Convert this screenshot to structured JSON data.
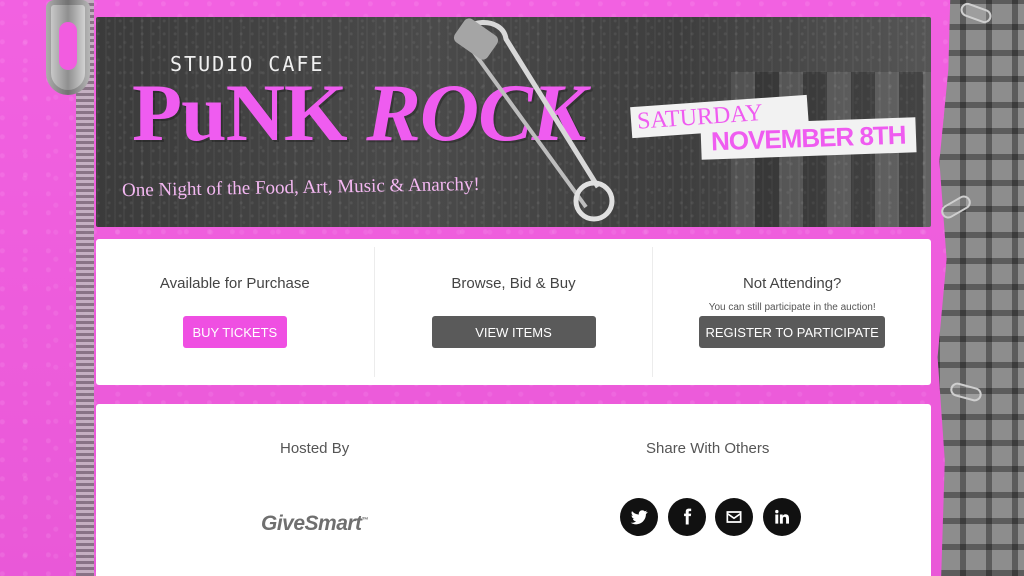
{
  "banner": {
    "venue": "STUDIO CAFE",
    "headline_word1": "PuNK",
    "headline_word2": "ROCK",
    "tagline": "One Night of the Food, Art, Music & Anarchy!",
    "date_day": "SATURDAY",
    "date_rest": "NOVEMBER 8TH"
  },
  "actions": {
    "purchase": {
      "title": "Available for Purchase",
      "button": "BUY TICKETS"
    },
    "browse": {
      "title": "Browse, Bid & Buy",
      "button": "VIEW ITEMS"
    },
    "register": {
      "title": "Not Attending?",
      "subtitle": "You can still participate in the auction!",
      "button": "REGISTER TO PARTICIPATE"
    }
  },
  "footer": {
    "hosted_title": "Hosted By",
    "host_name": "GiveSmart",
    "host_tm": "™",
    "share_title": "Share With Others",
    "social_icons": [
      "twitter-icon",
      "facebook-icon",
      "email-icon",
      "linkedin-icon"
    ]
  },
  "colors": {
    "pink_accent": "#ef4fe2",
    "dark_button": "#5a5a5a",
    "page_background": "#f25ce0"
  }
}
